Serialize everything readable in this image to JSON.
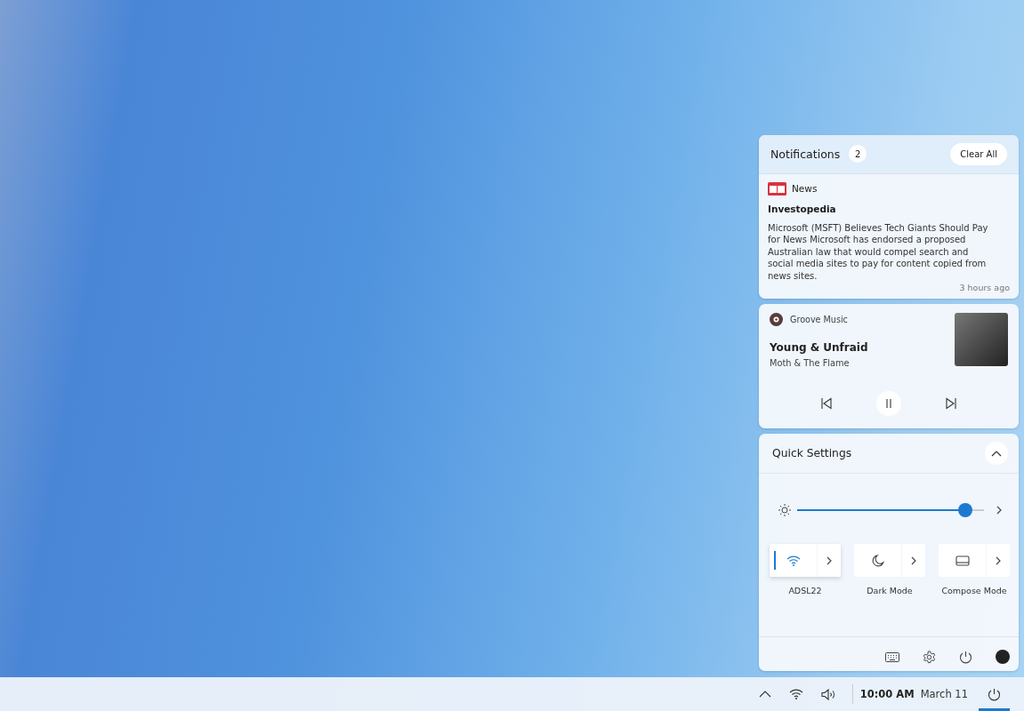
{
  "notifications": {
    "title": "Notifications",
    "count": "2",
    "clear_button": "Clear All",
    "items": [
      {
        "app": "News",
        "source": "Investopedia",
        "body": "Microsoft (MSFT) Believes Tech Giants Should Pay for News Microsoft has endorsed a proposed Australian law that would compel search and social media sites to pay for content copied from news sites.",
        "time": "3 hours ago"
      }
    ]
  },
  "media": {
    "app": "Groove Music",
    "title": "Young & Unfraid",
    "artist": "Moth & The Flame"
  },
  "quick_settings": {
    "title": "Quick Settings",
    "brightness": {
      "level": 0.9
    },
    "tiles": [
      {
        "kind": "wifi",
        "label": "ADSL22",
        "on": true
      },
      {
        "kind": "moon",
        "label": "Dark Mode",
        "on": false
      },
      {
        "kind": "compose",
        "label": "Compose Mode",
        "on": false
      }
    ]
  },
  "taskbar": {
    "time": "10:00 AM",
    "date": "March 11"
  }
}
